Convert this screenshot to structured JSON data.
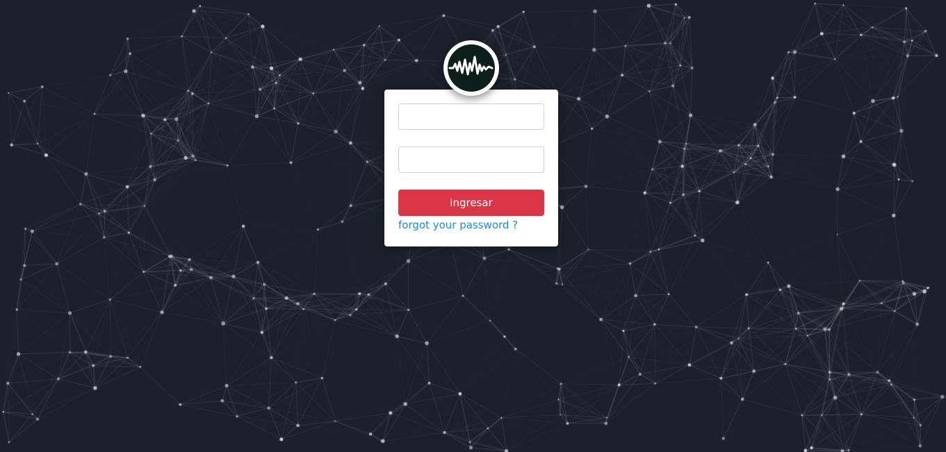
{
  "login": {
    "username": {
      "value": "",
      "placeholder": ""
    },
    "password": {
      "value": "",
      "placeholder": ""
    },
    "submit_label": "ingresar",
    "forgot_label": "forgot your password ?"
  },
  "logo": {
    "icon": "waveform-logo-icon"
  },
  "colors": {
    "background": "#1b202b",
    "network_line": "#ffffff",
    "network_node": "#cfd3d8",
    "card": "#ffffff",
    "button": "#dc3545",
    "link": "#1e88e5",
    "logo_inner": "#0d1f1b"
  }
}
